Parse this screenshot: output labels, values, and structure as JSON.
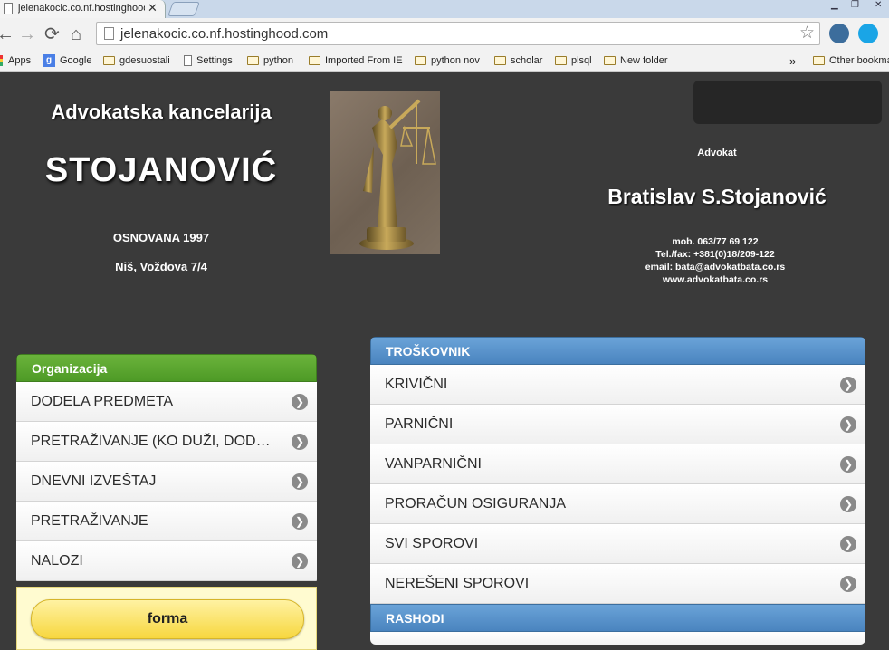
{
  "browser": {
    "tab_title": "jelenakocic.co.nf.hostinghood",
    "url": "jelenakocic.co.nf.hostinghood.com",
    "bookmarks": [
      "Apps",
      "Google",
      "gdesuostali",
      "Settings",
      "python",
      "Imported From IE",
      "python nov",
      "scholar",
      "plsql",
      "New folder"
    ],
    "overflow": "»",
    "other_bookmarks": "Other bookmarks"
  },
  "header": {
    "firm_title": "Advokatska kancelarija",
    "firm_name": "STOJANOVIĆ",
    "founded": "OSNOVANA 1997",
    "address": "Niš, Voždova 7/4",
    "advocate_label": "Advokat",
    "advocate_name": "Bratislav S.Stojanović",
    "mobile": "mob. 063/77 69 122",
    "telfax": "Tel./fax: +381(0)18/209-122",
    "email": "email: bata@advokatbata.co.rs",
    "website": "www.advokatbata.co.rs"
  },
  "organizacija": {
    "title": "Organizacija",
    "items": [
      "DODELA PREDMETA",
      "PRETRAŽIVANJE (KO DUŽI, DODELI...",
      "DNEVNI IZVEŠTAJ",
      "PRETRAŽIVANJE",
      "NALOZI"
    ]
  },
  "form": {
    "label": "forma"
  },
  "troskovnik": {
    "title": "TROŠKOVNIK",
    "items": [
      "KRIVIČNI",
      "PARNIČNI",
      "VANPARNIČNI",
      "PRORAČUN OSIGURANJA",
      "SVI SPOROVI",
      "NEREŠENI SPOROVI"
    ]
  },
  "rashodi": {
    "title": "RASHODI"
  }
}
